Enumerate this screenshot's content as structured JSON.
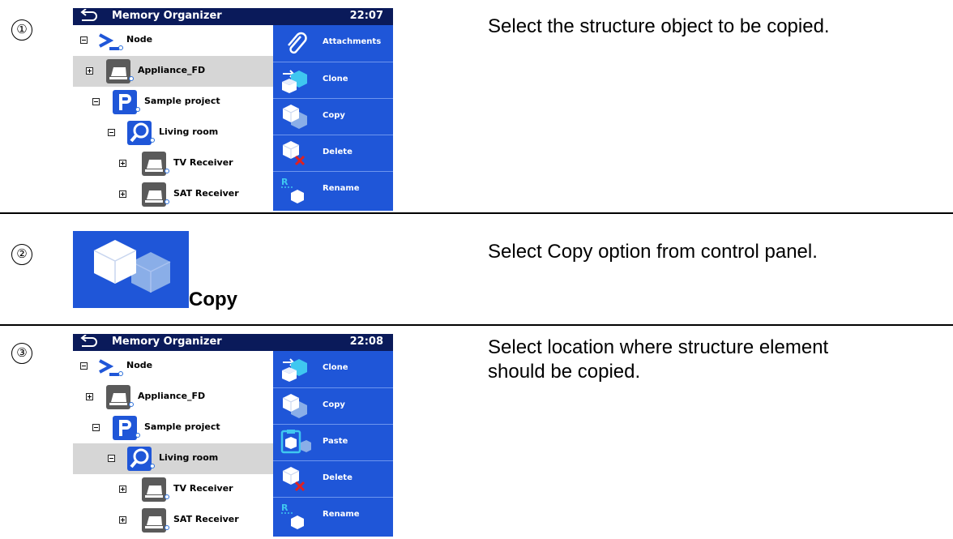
{
  "steps": [
    {
      "number": "①",
      "description": "Select the structure object to be copied.",
      "screen": {
        "title": "Memory Organizer",
        "time": "22:07",
        "tree": [
          {
            "label": "Node",
            "icon": "node-icon",
            "expander": "minus",
            "selected": false
          },
          {
            "label": "Appliance_FD",
            "icon": "appliance-icon",
            "expander": "plus",
            "selected": true
          },
          {
            "label": "Sample project",
            "icon": "project-icon",
            "expander": "minus",
            "selected": false
          },
          {
            "label": "Living room",
            "icon": "location-icon",
            "expander": "minus",
            "selected": false
          },
          {
            "label": "TV Receiver",
            "icon": "appliance-icon",
            "expander": "plus",
            "selected": false
          },
          {
            "label": "SAT Receiver",
            "icon": "appliance-icon",
            "expander": "plus",
            "selected": false
          }
        ],
        "panel": [
          "Attachments",
          "Clone",
          "Copy",
          "Delete",
          "Rename"
        ]
      }
    },
    {
      "number": "②",
      "description": "Select Copy option from control panel.",
      "button_label": "Copy",
      "button_icon": "copy-icon"
    },
    {
      "number": "③",
      "description": "Select location where structure element should be copied.",
      "screen": {
        "title": "Memory Organizer",
        "time": "22:08",
        "tree": [
          {
            "label": "Node",
            "icon": "node-icon",
            "expander": "minus",
            "selected": false
          },
          {
            "label": "Appliance_FD",
            "icon": "appliance-icon",
            "expander": "plus",
            "selected": false
          },
          {
            "label": "Sample project",
            "icon": "project-icon",
            "expander": "minus",
            "selected": false
          },
          {
            "label": "Living room",
            "icon": "location-icon",
            "expander": "minus",
            "selected": true
          },
          {
            "label": "TV Receiver",
            "icon": "appliance-icon",
            "expander": "plus",
            "selected": false
          },
          {
            "label": "SAT Receiver",
            "icon": "appliance-icon",
            "expander": "plus",
            "selected": false
          }
        ],
        "panel": [
          "Clone",
          "Copy",
          "Paste",
          "Delete",
          "Rename"
        ]
      }
    }
  ],
  "colors": {
    "title_bar": "#0a1a5a",
    "panel_blue": "#1f56d8",
    "selected_row": "#d6d6d6",
    "divider": "#000000"
  }
}
